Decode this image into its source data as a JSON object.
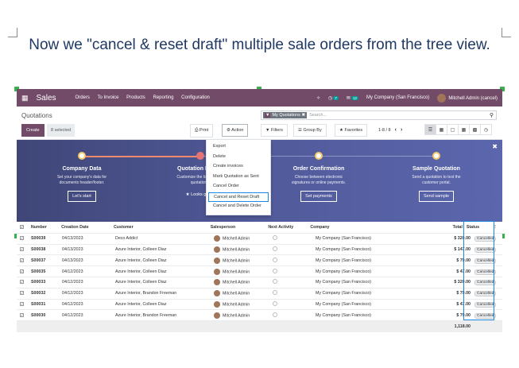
{
  "headline": "Now we \"cancel & reset draft\" multiple sale orders from the tree view.",
  "navbar": {
    "app": "Sales",
    "menu": [
      "Orders",
      "To Invoice",
      "Products",
      "Reporting",
      "Configuration"
    ],
    "activity_badge": "7",
    "messages_badge": "12",
    "company": "My Company (San Francisco)",
    "user": "Mitchell Admin (cancel)"
  },
  "control": {
    "breadcrumb": "Quotations",
    "facet": "My Quotations",
    "search_placeholder": "Search...",
    "create": "Create",
    "selected": "8 selected",
    "print": "Print",
    "action": "Action",
    "filters": "Filters",
    "group_by": "Group By",
    "favorites": "Favorites",
    "pager": "1-8 / 8"
  },
  "action_menu": [
    "Export",
    "Delete",
    "Create invoices",
    "Mark Quotation as Sent",
    "Cancel Order",
    "Cancel and Reset Draft",
    "Cancel and Delete Order"
  ],
  "banner": {
    "steps": [
      {
        "title": "Company Data",
        "desc1": "Set your company's data for",
        "desc2": "documents header/footer.",
        "button": "Let's start"
      },
      {
        "title": "Quotation Layout",
        "desc1": "Customize the look of your",
        "desc2": "quotations.",
        "button": "Looks great!"
      },
      {
        "title": "Order Confirmation",
        "desc1": "Choose between electronic",
        "desc2": "signatures or online payments.",
        "button": "Set payments"
      },
      {
        "title": "Sample Quotation",
        "desc1": "Send a quotation to test the",
        "desc2": "customer portal.",
        "button": "Send sample"
      }
    ]
  },
  "table": {
    "headers": [
      "Number",
      "Creation Date",
      "Customer",
      "Salesperson",
      "Next Activity",
      "Company",
      "Total",
      "Status"
    ],
    "rows": [
      {
        "number": "S00039",
        "date": "04/13/2023",
        "customer": "Deco Addict",
        "salesperson": "Mitchell Admin",
        "company": "My Company (San Francisco)",
        "total": "$ 320.00",
        "status": "Cancelled"
      },
      {
        "number": "S00038",
        "date": "04/13/2023",
        "customer": "Azure Interior, Colleen Diaz",
        "salesperson": "Mitchell Admin",
        "company": "My Company (San Francisco)",
        "total": "$ 147.00",
        "status": "Cancelled"
      },
      {
        "number": "S00037",
        "date": "04/13/2023",
        "customer": "Azure Interior, Colleen Diaz",
        "salesperson": "Mitchell Admin",
        "company": "My Company (San Francisco)",
        "total": "$ 79.00",
        "status": "Cancelled"
      },
      {
        "number": "S00035",
        "date": "04/12/2023",
        "customer": "Azure Interior, Colleen Diaz",
        "salesperson": "Mitchell Admin",
        "company": "My Company (San Francisco)",
        "total": "$ 47.00",
        "status": "Cancelled"
      },
      {
        "number": "S00033",
        "date": "04/12/2023",
        "customer": "Azure Interior, Colleen Diaz",
        "salesperson": "Mitchell Admin",
        "company": "My Company (San Francisco)",
        "total": "$ 320.00",
        "status": "Cancelled"
      },
      {
        "number": "S00032",
        "date": "04/12/2023",
        "customer": "Azure Interior, Brandon Freeman",
        "salesperson": "Mitchell Admin",
        "company": "My Company (San Francisco)",
        "total": "$ 79.00",
        "status": "Cancelled"
      },
      {
        "number": "S00031",
        "date": "04/12/2023",
        "customer": "Azure Interior, Colleen Diaz",
        "salesperson": "Mitchell Admin",
        "company": "My Company (San Francisco)",
        "total": "$ 47.00",
        "status": "Cancelled"
      },
      {
        "number": "S00030",
        "date": "04/12/2023",
        "customer": "Azure Interior, Brandon Freeman",
        "salesperson": "Mitchell Admin",
        "company": "My Company (San Francisco)",
        "total": "$ 79.00",
        "status": "Cancelled"
      }
    ],
    "sum_total": "1,118.00"
  },
  "colors": {
    "brand": "#714b67",
    "highlight": "#1e88e5",
    "headline": "#1f3864"
  }
}
